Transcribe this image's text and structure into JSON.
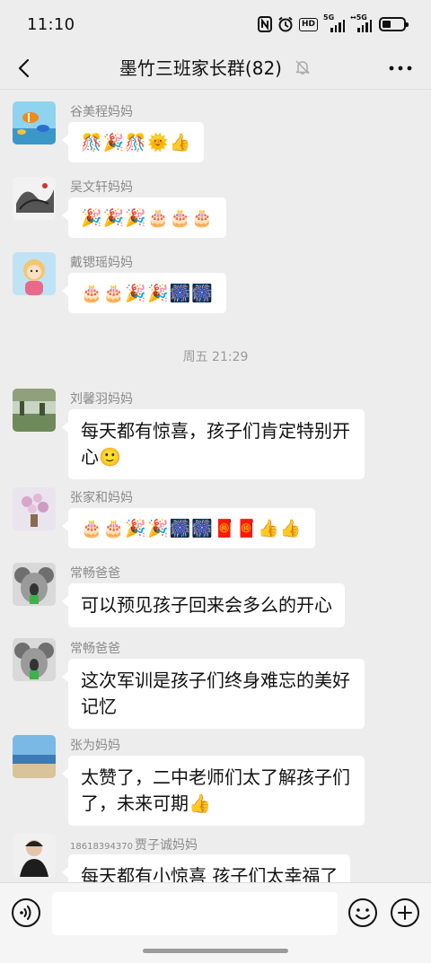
{
  "status_bar": {
    "time": "11:10",
    "hd_label": "HD",
    "sig1_label": "5G",
    "sig2_label": "↔5G"
  },
  "nav": {
    "title": "墨竹三班家长群(82)",
    "icons": [
      "back-icon",
      "mute-bell-icon",
      "more-icon"
    ]
  },
  "messages": [
    {
      "sender": "谷美程妈妈",
      "content": "🎊🎉🎊🌞👍"
    },
    {
      "sender": "吴文轩妈妈",
      "content": "🎉🎉🎉🎂🎂🎂"
    },
    {
      "sender": "戴锶瑶妈妈",
      "content": "🎂🎂🎉🎉🎆🎆"
    },
    {
      "divider": "周五 21:29"
    },
    {
      "sender": "刘馨羽妈妈",
      "content_line1": "每天都有惊喜，孩子们肯定特别开",
      "content_line2": "心🙂"
    },
    {
      "sender": "张家和妈妈",
      "content": "🎂🎂🎉🎉🎆🎆🧧🧧👍👍"
    },
    {
      "sender": "常畅爸爸",
      "content": "可以预见孩子回来会多么的开心"
    },
    {
      "sender": "常畅爸爸",
      "content_line1": "这次军训是孩子们终身难忘的美好",
      "content_line2": "记忆"
    },
    {
      "sender": "张为妈妈",
      "content_line1": "太赞了，二中老师们太了解孩子们",
      "content_line2": "了，未来可期👍"
    },
    {
      "sender_phone": "18618394370",
      "sender": "贾子诚妈妈",
      "content": "每天都有小惊喜 孩子们太幸福了"
    }
  ],
  "input_bar": {
    "icons": [
      "voice-icon",
      "emoji-face-icon",
      "plus-icon"
    ]
  }
}
